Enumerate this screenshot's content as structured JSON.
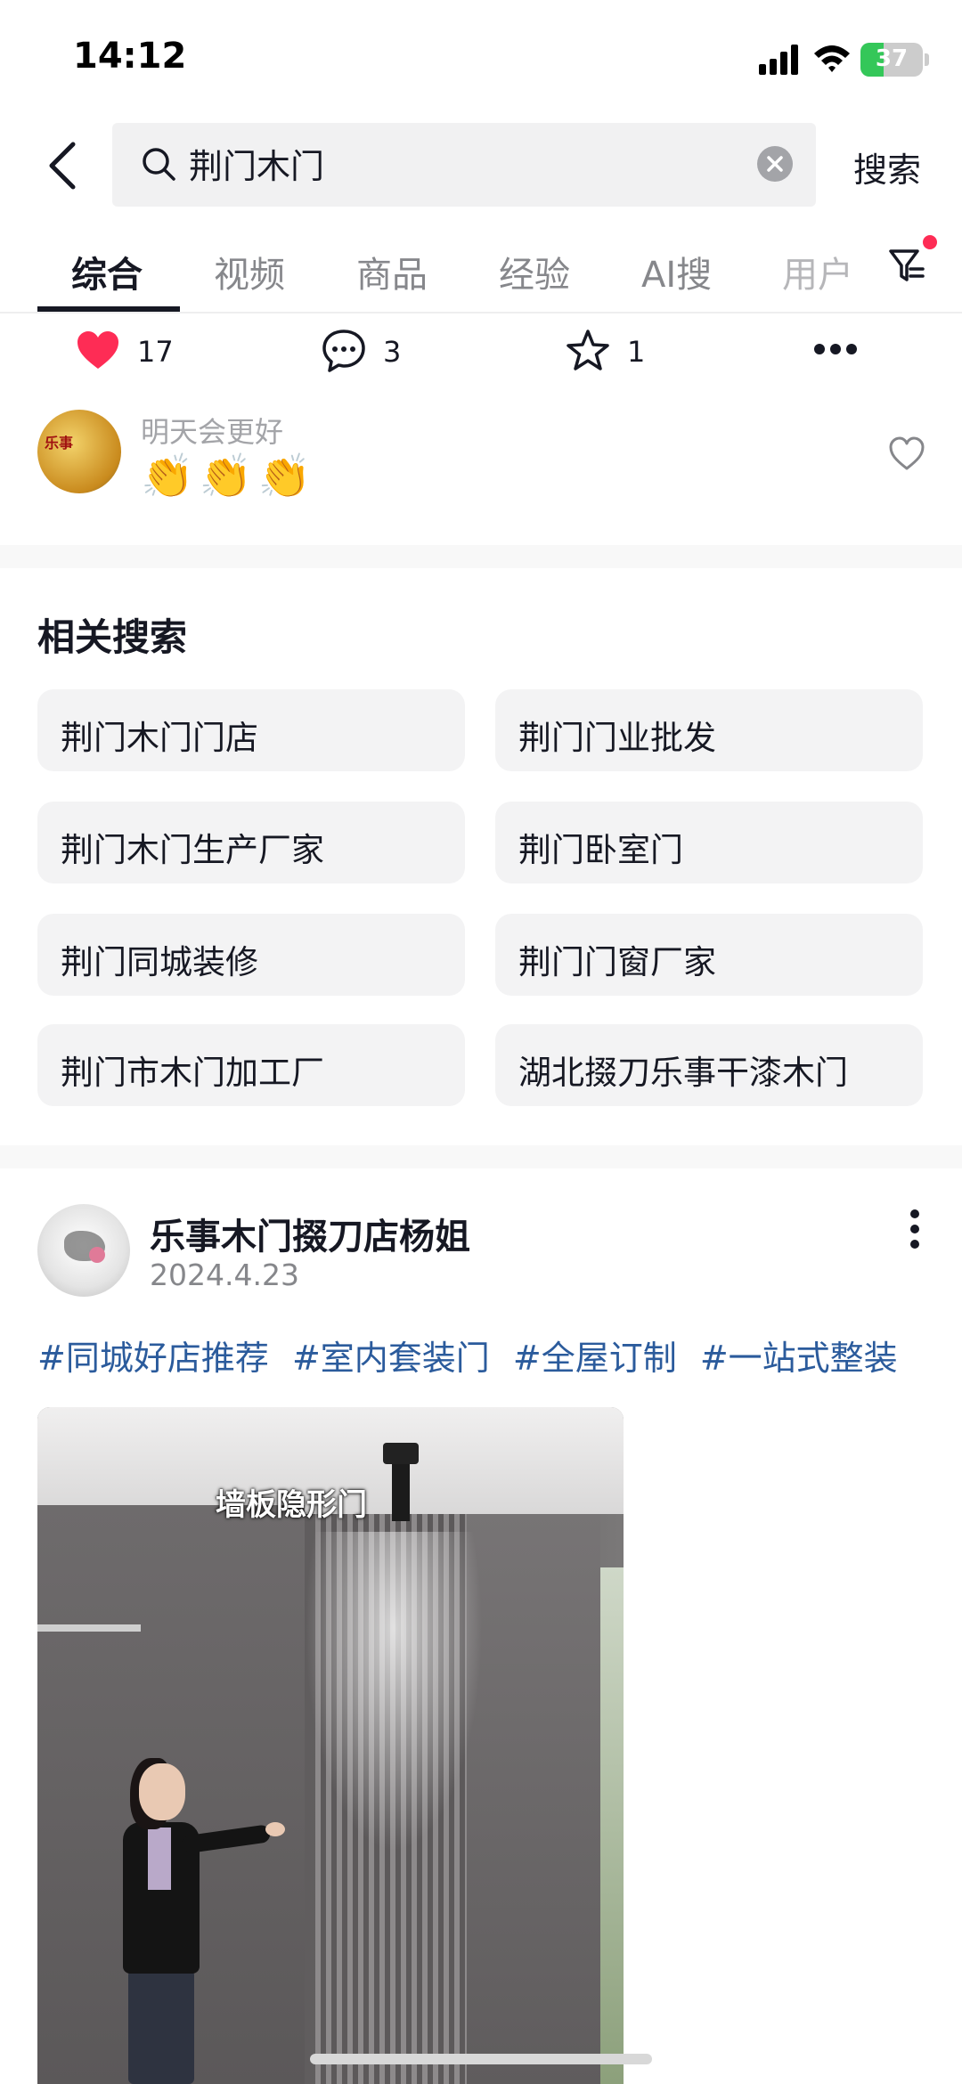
{
  "status_bar": {
    "time": "14:12",
    "battery": "37",
    "battery_level": 0.37
  },
  "search": {
    "query": "荆门木门",
    "submit_label": "搜索"
  },
  "tabs": [
    "综合",
    "视频",
    "商品",
    "经验",
    "AI搜",
    "用户"
  ],
  "active_tab": "综合",
  "actions": {
    "likes": "17",
    "comments": "3",
    "favorites": "1"
  },
  "comment": {
    "avatar_text": "乐事",
    "author": "明天会更好",
    "text": "👏👏👏"
  },
  "related": {
    "title": "相关搜索",
    "items": [
      "荆门木门门店",
      "荆门门业批发",
      "荆门木门生产厂家",
      "荆门卧室门",
      "荆门同城装修",
      "荆门门窗厂家",
      "荆门市木门加工厂",
      "湖北掇刀乐事干漆木门"
    ]
  },
  "post": {
    "author": "乐事木门掇刀店杨姐",
    "date": "2024.4.23",
    "hashtags": [
      "#同城好店推荐",
      "#室内套装门",
      "#全屋订制",
      "#一站式整装"
    ],
    "video_caption": "墙板隐形门"
  },
  "colors": {
    "accent_red": "#fe2c55",
    "hashtag_blue": "#2b5b9c",
    "battery_green": "#34c759"
  }
}
